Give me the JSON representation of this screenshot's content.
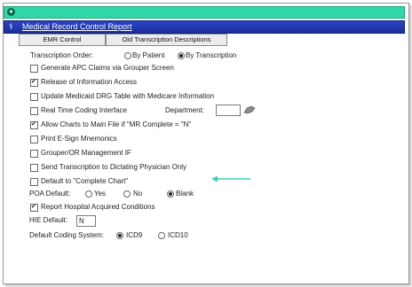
{
  "window": {
    "title": "Medical Record Control Report"
  },
  "tabs": [
    {
      "label": "EMR Control"
    },
    {
      "label": "Old Transcription Descriptions"
    }
  ],
  "transcription_order": {
    "label": "Transcription Order:",
    "options": [
      "By Patient",
      "By Transcription"
    ],
    "selected": "By Transcription"
  },
  "checks": [
    {
      "label": "Generate APC Claims via Grouper Screen",
      "checked": false
    },
    {
      "label": "Release of Information Access",
      "checked": true
    },
    {
      "label": "Update Medicaid DRG Table with Medicare Information",
      "checked": false
    },
    {
      "label": "Real Time Coding Interface",
      "checked": false
    },
    {
      "label": "Allow Charts to Main File if \"MR Complete = \"N\"",
      "checked": true
    },
    {
      "label": "Print E-Sign Mnemonics",
      "checked": false
    },
    {
      "label": "Grouper/OR Management IF",
      "checked": false
    },
    {
      "label": "Send Transcription to Dictating Physician Only",
      "checked": false
    },
    {
      "label": "Default to \"Complete Chart\"",
      "checked": false
    }
  ],
  "department": {
    "label": "Department:",
    "value": ""
  },
  "poa_default": {
    "label": "POA Default:",
    "options": [
      "Yes",
      "No",
      "Blank"
    ],
    "selected": "Blank"
  },
  "report_hac": {
    "label": "Report Hospital Acquired Conditions",
    "checked": true
  },
  "hie_default": {
    "label": "HIE Default:",
    "value": "N"
  },
  "coding_system": {
    "label": "Default Coding System:",
    "options": [
      "ICD9",
      "ICD10"
    ],
    "selected": "ICD9"
  },
  "colors": {
    "top_bar": "#2fd8a6",
    "title_bar": "#1a2f9a",
    "arrow": "#3fd0b8"
  }
}
